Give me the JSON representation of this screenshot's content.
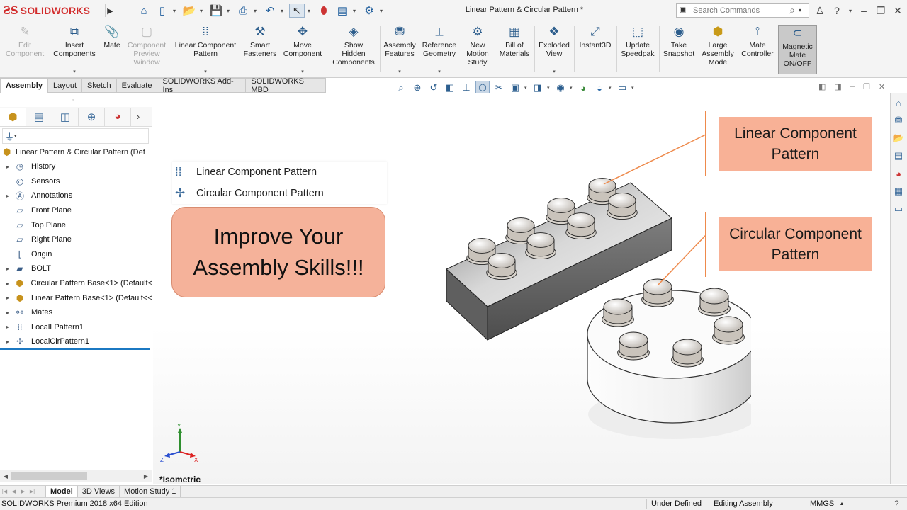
{
  "app": {
    "brand": "SOLIDWORKS",
    "document_title": "Linear Pattern & Circular Pattern *"
  },
  "search": {
    "placeholder": "Search Commands"
  },
  "ribbon": {
    "buttons": [
      {
        "label": "Edit\nComponent",
        "icon": "edit-component-icon",
        "enabled": false
      },
      {
        "label": "Insert\nComponents",
        "icon": "insert-components-icon",
        "enabled": true
      },
      {
        "label": "Mate",
        "icon": "mate-icon",
        "enabled": true
      },
      {
        "label": "Component\nPreview\nWindow",
        "icon": "component-preview-icon",
        "enabled": false
      },
      {
        "label": "Linear Component\nPattern",
        "icon": "linear-pattern-icon",
        "enabled": true
      },
      {
        "label": "Smart\nFasteners",
        "icon": "smart-fasteners-icon",
        "enabled": true
      },
      {
        "label": "Move\nComponent",
        "icon": "move-component-icon",
        "enabled": true
      },
      {
        "label": "Show\nHidden\nComponents",
        "icon": "show-hidden-icon",
        "enabled": true
      },
      {
        "label": "Assembly\nFeatures",
        "icon": "assembly-features-icon",
        "enabled": true
      },
      {
        "label": "Reference\nGeometry",
        "icon": "reference-geometry-icon",
        "enabled": true
      },
      {
        "label": "New\nMotion\nStudy",
        "icon": "motion-study-icon",
        "enabled": true
      },
      {
        "label": "Bill of\nMaterials",
        "icon": "bom-icon",
        "enabled": true
      },
      {
        "label": "Exploded\nView",
        "icon": "exploded-view-icon",
        "enabled": true
      },
      {
        "label": "Instant3D",
        "icon": "instant3d-icon",
        "enabled": true
      },
      {
        "label": "Update\nSpeedpak",
        "icon": "speedpak-icon",
        "enabled": true
      },
      {
        "label": "Take\nSnapshot",
        "icon": "snapshot-icon",
        "enabled": true
      },
      {
        "label": "Large\nAssembly\nMode",
        "icon": "large-assembly-icon",
        "enabled": true
      },
      {
        "label": "Mate\nController",
        "icon": "mate-controller-icon",
        "enabled": true
      },
      {
        "label": "Magnetic\nMate\nON/OFF",
        "icon": "magnetic-mate-icon",
        "enabled": true,
        "active": true
      }
    ]
  },
  "command_tabs": [
    "Assembly",
    "Layout",
    "Sketch",
    "Evaluate",
    "SOLIDWORKS Add-Ins",
    "SOLIDWORKS MBD"
  ],
  "active_command_tab": "Assembly",
  "feature_tree": {
    "root": "Linear Pattern & Circular Pattern  (Def",
    "items": [
      {
        "label": "History",
        "icon": "history-icon",
        "expandable": true
      },
      {
        "label": "Sensors",
        "icon": "sensors-icon",
        "expandable": false
      },
      {
        "label": "Annotations",
        "icon": "annotations-icon",
        "expandable": true
      },
      {
        "label": "Front Plane",
        "icon": "plane-icon",
        "expandable": false
      },
      {
        "label": "Top Plane",
        "icon": "plane-icon",
        "expandable": false
      },
      {
        "label": "Right Plane",
        "icon": "plane-icon",
        "expandable": false
      },
      {
        "label": "Origin",
        "icon": "origin-icon",
        "expandable": false
      },
      {
        "label": "BOLT",
        "icon": "folder-icon",
        "expandable": true
      },
      {
        "label": "Circular Pattern Base<1> (Default<",
        "icon": "part-icon",
        "expandable": true
      },
      {
        "label": "Linear Pattern Base<1> (Default<<",
        "icon": "part-icon",
        "expandable": true
      },
      {
        "label": "Mates",
        "icon": "mates-icon",
        "expandable": true
      },
      {
        "label": "LocalLPattern1",
        "icon": "linear-pattern-icon",
        "expandable": true
      },
      {
        "label": "LocalCirPattern1",
        "icon": "circular-pattern-icon",
        "expandable": true
      }
    ]
  },
  "pattern_menu": {
    "items": [
      "Linear Component Pattern",
      "Circular Component Pattern"
    ]
  },
  "callout": {
    "text": "Improve Your\nAssembly Skills!!!"
  },
  "labels": {
    "linear": "Linear Component\nPattern",
    "circular": "Circular Component\nPattern"
  },
  "graphics": {
    "view_name": "*Isometric",
    "triad": {
      "x": "X",
      "y": "Y",
      "z": "Z"
    }
  },
  "bottom_tabs": [
    "Model",
    "3D Views",
    "Motion Study 1"
  ],
  "active_bottom_tab": "Model",
  "status": {
    "edition": "SOLIDWORKS Premium 2018 x64 Edition",
    "definition": "Under Defined",
    "mode": "Editing Assembly",
    "units": "MMGS"
  },
  "colors": {
    "callout_fill": "#f5b29a",
    "label_fill": "#f8b196",
    "leader": "#ee8a4c",
    "brand_red": "#d22b2b"
  }
}
